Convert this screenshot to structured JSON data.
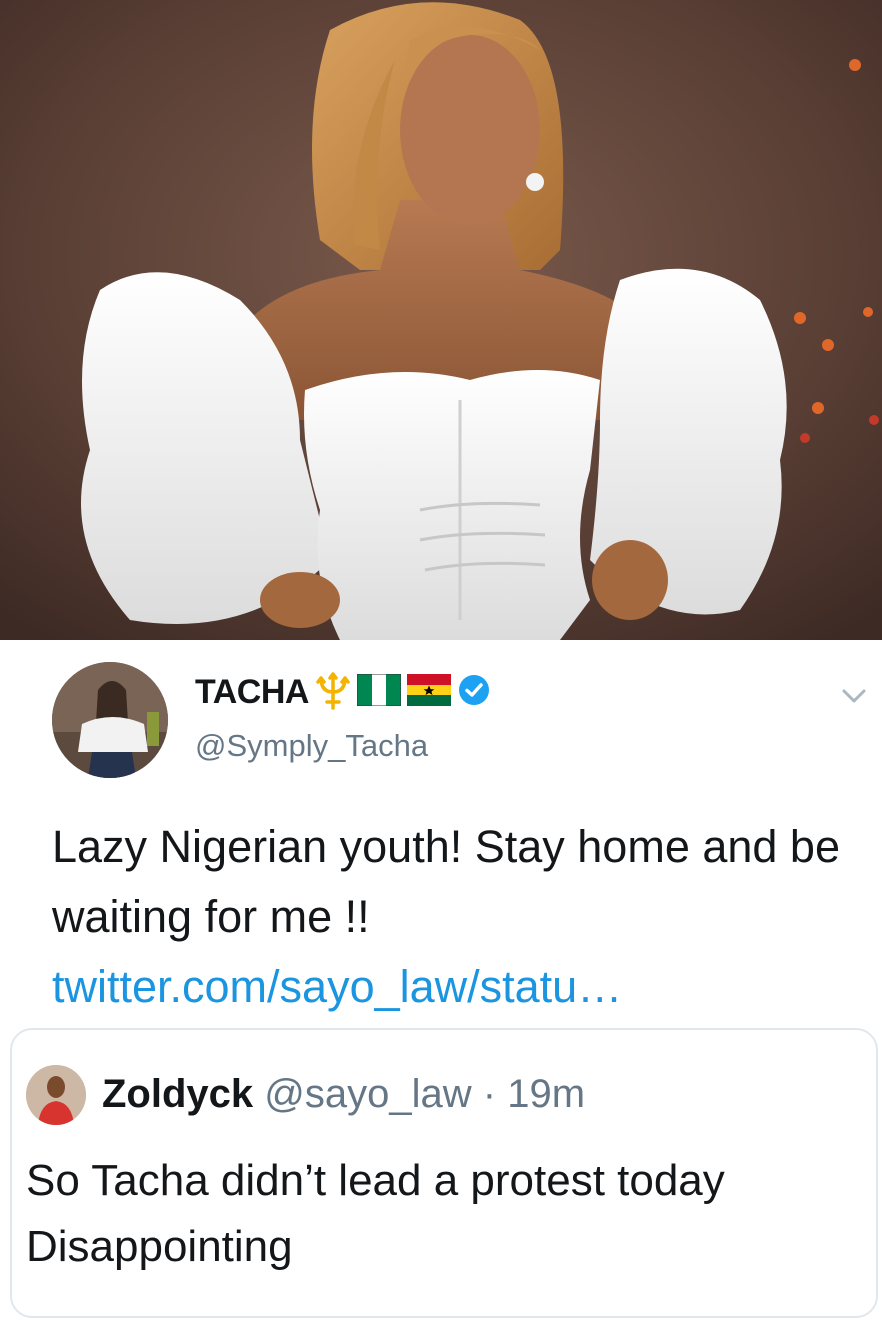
{
  "tweet": {
    "display_name": "TACHA",
    "name_emojis": [
      "trident",
      "nigeria-flag",
      "ghana-flag"
    ],
    "verified": true,
    "handle": "@Symply_Tacha",
    "text": "Lazy Nigerian youth! Stay home and be waiting for me !!",
    "link": "twitter.com/sayo_law/statu…"
  },
  "quoted": {
    "display_name": "Zoldyck",
    "handle": "@sayo_law",
    "separator": "·",
    "time": "19m",
    "line1": "So Tacha didn’t lead a protest today",
    "line2": "Disappointing"
  },
  "colors": {
    "link": "#1b95e0",
    "verified": "#1da1f2",
    "secondary_text": "#657786",
    "border": "#e1e8ed"
  },
  "icons": {
    "verified": "verified-badge-icon",
    "menu": "chevron-down-icon"
  }
}
